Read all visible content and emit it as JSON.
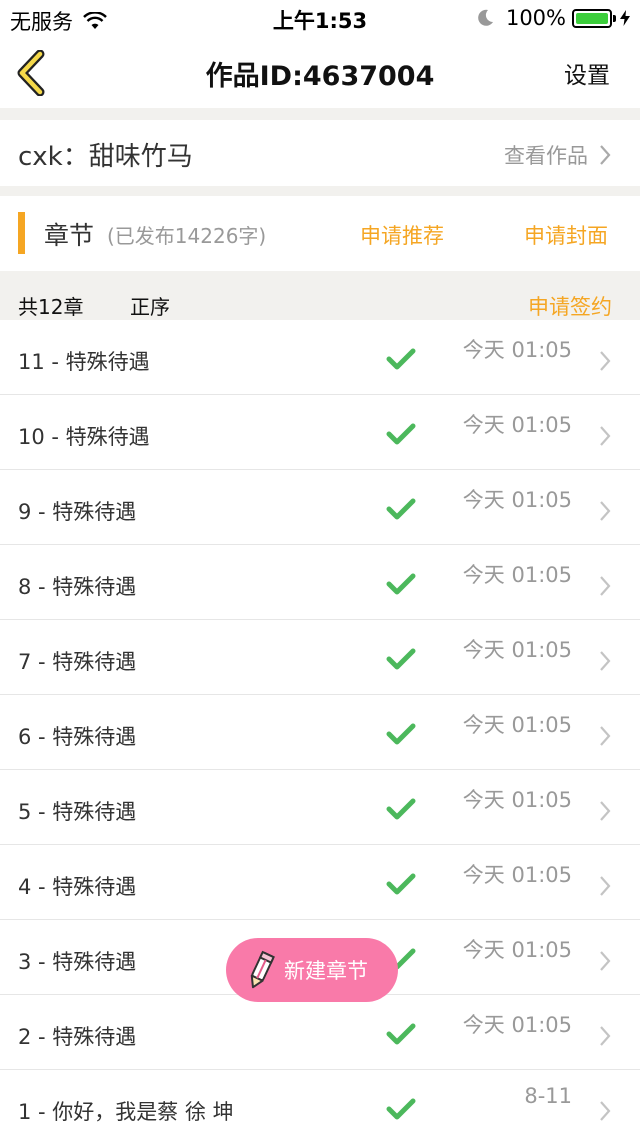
{
  "status_bar": {
    "carrier": "无服务",
    "time": "上午1:53",
    "battery": "100%"
  },
  "nav": {
    "title": "作品ID:4637004",
    "settings_label": "设置"
  },
  "work": {
    "name": "cxk：甜味竹马",
    "view_label": "查看作品"
  },
  "chapter_section": {
    "title": "章节",
    "published": "(已发布14226字)",
    "recommend_label": "申请推荐",
    "cover_label": "申请封面"
  },
  "filter": {
    "total": "共12章",
    "order": "正序",
    "sign_label": "申请签约"
  },
  "chapters": [
    {
      "title": "11 - 特殊待遇",
      "time": "今天 01:05"
    },
    {
      "title": "10 - 特殊待遇",
      "time": "今天 01:05"
    },
    {
      "title": "9 - 特殊待遇",
      "time": "今天 01:05"
    },
    {
      "title": "8 - 特殊待遇",
      "time": "今天 01:05"
    },
    {
      "title": "7 - 特殊待遇",
      "time": "今天 01:05"
    },
    {
      "title": "6 - 特殊待遇",
      "time": "今天 01:05"
    },
    {
      "title": "5 - 特殊待遇",
      "time": "今天 01:05"
    },
    {
      "title": "4 - 特殊待遇",
      "time": "今天 01:05"
    },
    {
      "title": "3 - 特殊待遇",
      "time": "今天 01:05"
    },
    {
      "title": "2 - 特殊待遇",
      "time": "今天 01:05"
    },
    {
      "title": "1 - 你好，我是蔡 徐 坤",
      "time": "8-11"
    }
  ],
  "fab": {
    "label": "新建章节"
  },
  "colors": {
    "accent": "#f5a623",
    "check": "#4cb85c",
    "fab": "#f97aa9",
    "divider_bg": "#f2f1ee"
  },
  "icons": [
    "wifi-icon",
    "moon-icon",
    "battery-icon",
    "bolt-icon",
    "back-arrow-icon",
    "chevron-right-icon",
    "check-icon",
    "pencil-icon"
  ]
}
